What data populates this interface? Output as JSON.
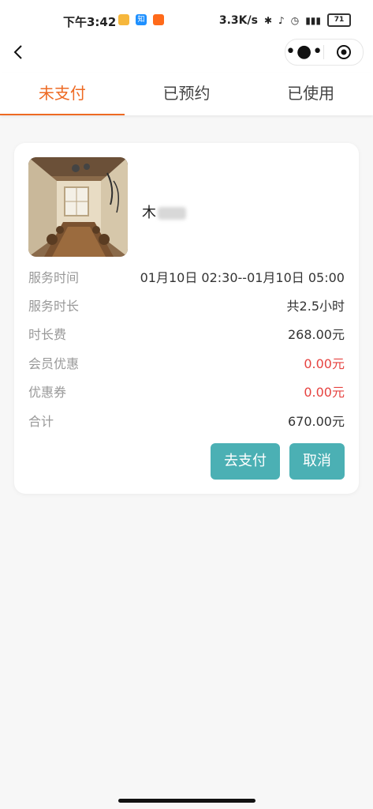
{
  "status": {
    "time": "下午3:42",
    "app_zhi": "知",
    "net_speed": "3.3K/s",
    "battery": "71"
  },
  "tabs": [
    {
      "label": "未支付",
      "active": true
    },
    {
      "label": "已预约",
      "active": false
    },
    {
      "label": "已使用",
      "active": false
    }
  ],
  "order": {
    "name": "木",
    "rows": [
      {
        "label": "服务时间",
        "value": "01月10日 02:30--01月10日 05:00",
        "highlight": false
      },
      {
        "label": "服务时长",
        "value": "共2.5小时",
        "highlight": false
      },
      {
        "label": "时长费",
        "value": "268.00元",
        "highlight": false
      },
      {
        "label": "会员优惠",
        "value": "0.00元",
        "highlight": true
      },
      {
        "label": "优惠券",
        "value": "0.00元",
        "highlight": true
      },
      {
        "label": "合计",
        "value": "670.00元",
        "highlight": false
      }
    ],
    "pay_label": "去支付",
    "cancel_label": "取消"
  },
  "colors": {
    "accent": "#ee6a23",
    "button": "#4bb0b4",
    "discount": "#e64340"
  }
}
